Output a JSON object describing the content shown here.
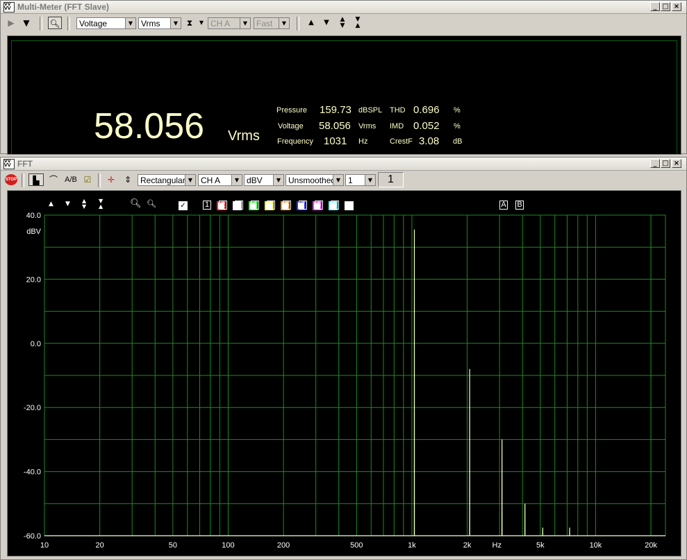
{
  "multimeter": {
    "title": "Multi-Meter (FFT Slave)",
    "mode_select": "Voltage",
    "unit_select": "Vrms",
    "channel_select": "CH A",
    "speed_select": "Fast",
    "main_value": "58.056",
    "main_unit": "Vrms",
    "readouts": [
      {
        "label": "Pressure",
        "value": "159.73",
        "unit": "dBSPL"
      },
      {
        "label": "Voltage",
        "value": "58.056",
        "unit": "Vrms"
      },
      {
        "label": "Frequency",
        "value": "1031",
        "unit": "Hz"
      }
    ],
    "distortion": [
      {
        "label": "THD",
        "value": "0.696",
        "unit": "%"
      },
      {
        "label": "IMD",
        "value": "0.052",
        "unit": "%"
      },
      {
        "label": "CrestF",
        "value": "3.08",
        "unit": "dB"
      }
    ]
  },
  "fft": {
    "title": "FFT",
    "window_select": "Rectangular",
    "channel_select": "CH A",
    "unit_select": "dBV",
    "smoothing_select": "Unsmoothed",
    "average_select": "1",
    "average_readout": "1",
    "stop_label": "STOP",
    "ab_label": "A/B",
    "traces": [
      {
        "num": "1",
        "color": "#ff2a2a"
      },
      {
        "num": "2",
        "color": "#ffffff"
      },
      {
        "num": "3",
        "color": "#22ff22"
      },
      {
        "num": "4",
        "color": "#ffff33"
      },
      {
        "num": "5",
        "color": "#ff9933"
      },
      {
        "num": "6",
        "color": "#3333ff"
      },
      {
        "num": "7",
        "color": "#ff33ff"
      },
      {
        "num": "8",
        "color": "#66ffff"
      },
      {
        "num": "9",
        "color": "#ffffff"
      }
    ],
    "trace_ab": [
      "A",
      "B"
    ]
  },
  "chart_data": {
    "type": "line",
    "title": "",
    "xlabel": "Hz",
    "ylabel": "dBV",
    "x_scale": "log",
    "xlim": [
      10,
      24000
    ],
    "ylim": [
      -60,
      40
    ],
    "x_ticks": [
      {
        "v": 10,
        "label": "10"
      },
      {
        "v": 20,
        "label": "20"
      },
      {
        "v": 50,
        "label": "50"
      },
      {
        "v": 100,
        "label": "100"
      },
      {
        "v": 200,
        "label": "200"
      },
      {
        "v": 500,
        "label": "500"
      },
      {
        "v": 1000,
        "label": "1k"
      },
      {
        "v": 2000,
        "label": "2k"
      },
      {
        "v": 5000,
        "label": "5k"
      },
      {
        "v": 10000,
        "label": "10k"
      },
      {
        "v": 20000,
        "label": "20k"
      }
    ],
    "y_ticks": [
      {
        "v": 40,
        "label": "40.0"
      },
      {
        "v": 20,
        "label": "20.0"
      },
      {
        "v": 0,
        "label": "0.0"
      },
      {
        "v": -20,
        "label": "-20.0"
      },
      {
        "v": -40,
        "label": "-40.0"
      },
      {
        "v": -60,
        "label": "-60.0"
      }
    ],
    "grid": true,
    "grid_color": "#1e8c1e",
    "trace_color": "#ffffcc",
    "series": [
      {
        "points": [
          [
            1030,
            -60
          ],
          [
            1031,
            35.5
          ],
          [
            1032,
            -60
          ],
          [
            2060,
            -60
          ],
          [
            2062,
            -8
          ],
          [
            2064,
            -60
          ],
          [
            3090,
            -60
          ],
          [
            3093,
            -30
          ],
          [
            3096,
            -60
          ],
          [
            4120,
            -60
          ],
          [
            4124,
            -50
          ],
          [
            4128,
            -60
          ],
          [
            5150,
            -60
          ],
          [
            5155,
            -57.5
          ],
          [
            5160,
            -60
          ],
          [
            7210,
            -60
          ],
          [
            7217,
            -57.5
          ],
          [
            7224,
            -60
          ]
        ]
      }
    ]
  }
}
